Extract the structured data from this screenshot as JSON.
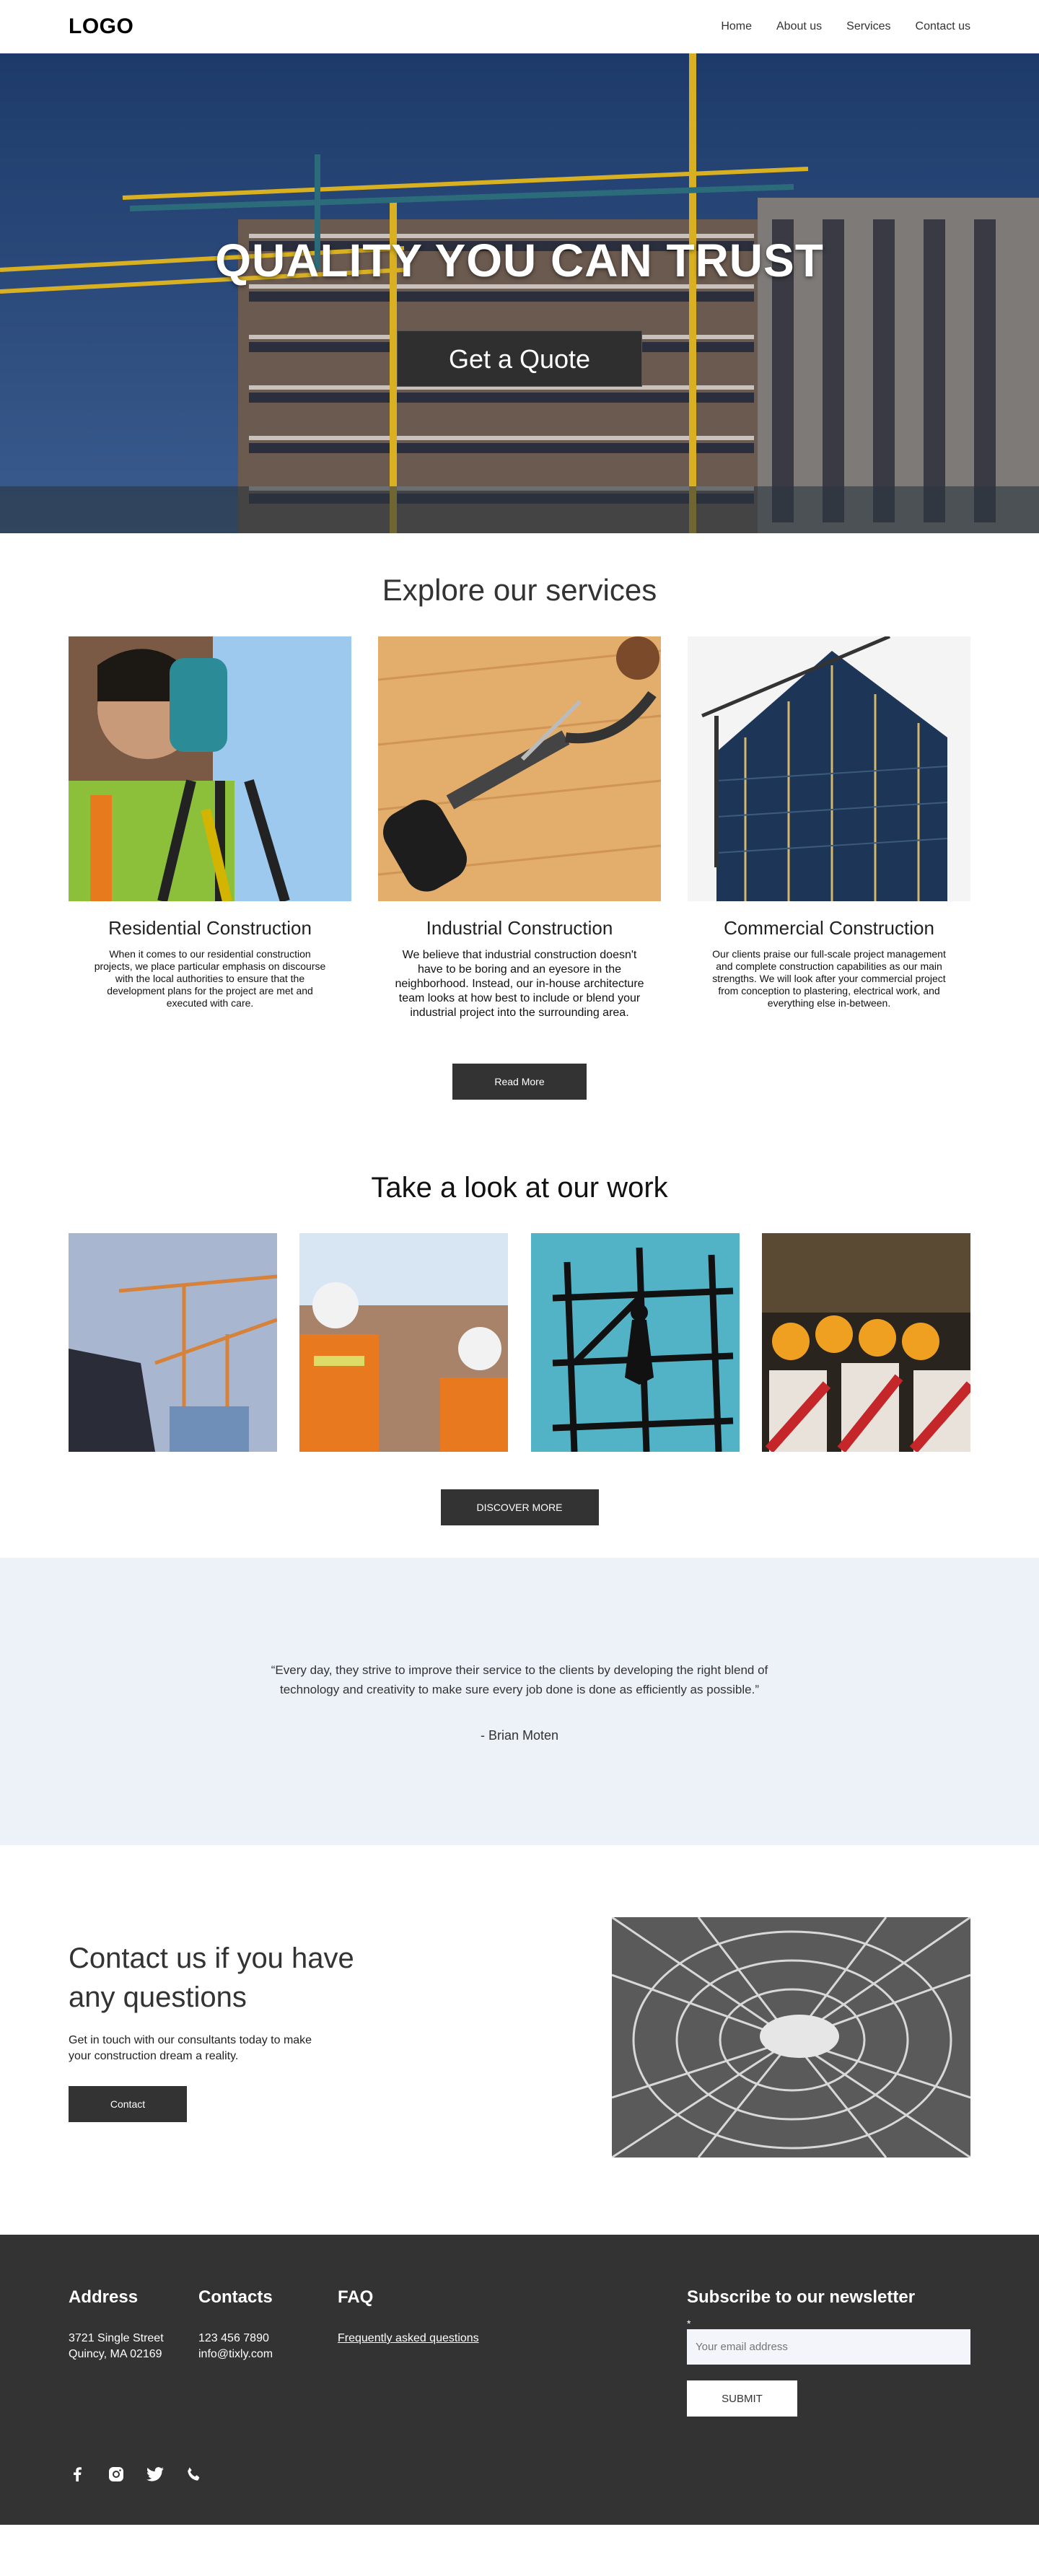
{
  "header": {
    "logo": "LOGO",
    "nav": [
      "Home",
      "About us",
      "Services",
      "Contact us"
    ]
  },
  "hero": {
    "title": "QUALITY YOU CAN TRUST",
    "button": "Get a Quote"
  },
  "services": {
    "title": "Explore our services",
    "cards": [
      {
        "title": "Residential Construction",
        "text": "When it comes to our residential construction projects, we place particular emphasis on discourse with the local authorities to ensure that the development plans for the project are met and executed with care."
      },
      {
        "title": "Industrial Construction",
        "text": "We believe that industrial construction doesn't have to be boring and an eyesore in the neighborhood. Instead, our in-house architecture team looks at how best to include or blend your industrial project into the surrounding area."
      },
      {
        "title": "Commercial Construction",
        "text": "Our clients praise our full-scale project management and complete construction capabilities as our main strengths. We will look after your commercial project from conception to plastering, electrical work, and everything else in-between."
      }
    ],
    "button": "Read More"
  },
  "work": {
    "title": "Take a look at our work",
    "button": "DISCOVER MORE"
  },
  "testimonial": {
    "quote": "“Every day, they strive to improve their service to the clients by developing the right blend of technology and creativity to make sure every job done is done as efficiently as possible.”",
    "author": "- Brian Moten"
  },
  "contact": {
    "title": "Contact us if you have any questions",
    "text": "Get in touch with our consultants today to make your construction dream a reality.",
    "button": "Contact"
  },
  "footer": {
    "address_title": "Address",
    "address_line1": "3721 Single Street",
    "address_line2": "Quincy, MA 02169",
    "contacts_title": "Contacts",
    "phone": "123 456 7890",
    "email": "info@tixly.com",
    "faq_title": "FAQ",
    "faq_link": "Frequently asked questions",
    "newsletter_title": "Subscribe to our newsletter",
    "required_mark": "*",
    "email_placeholder": "Your email address",
    "submit": "SUBMIT",
    "socials": [
      "facebook-icon",
      "instagram-icon",
      "twitter-icon",
      "phone-icon"
    ]
  },
  "colors": {
    "dark": "#333333",
    "testimonial_bg": "#edf1f8",
    "hero_sky": "#1e3b6b"
  }
}
